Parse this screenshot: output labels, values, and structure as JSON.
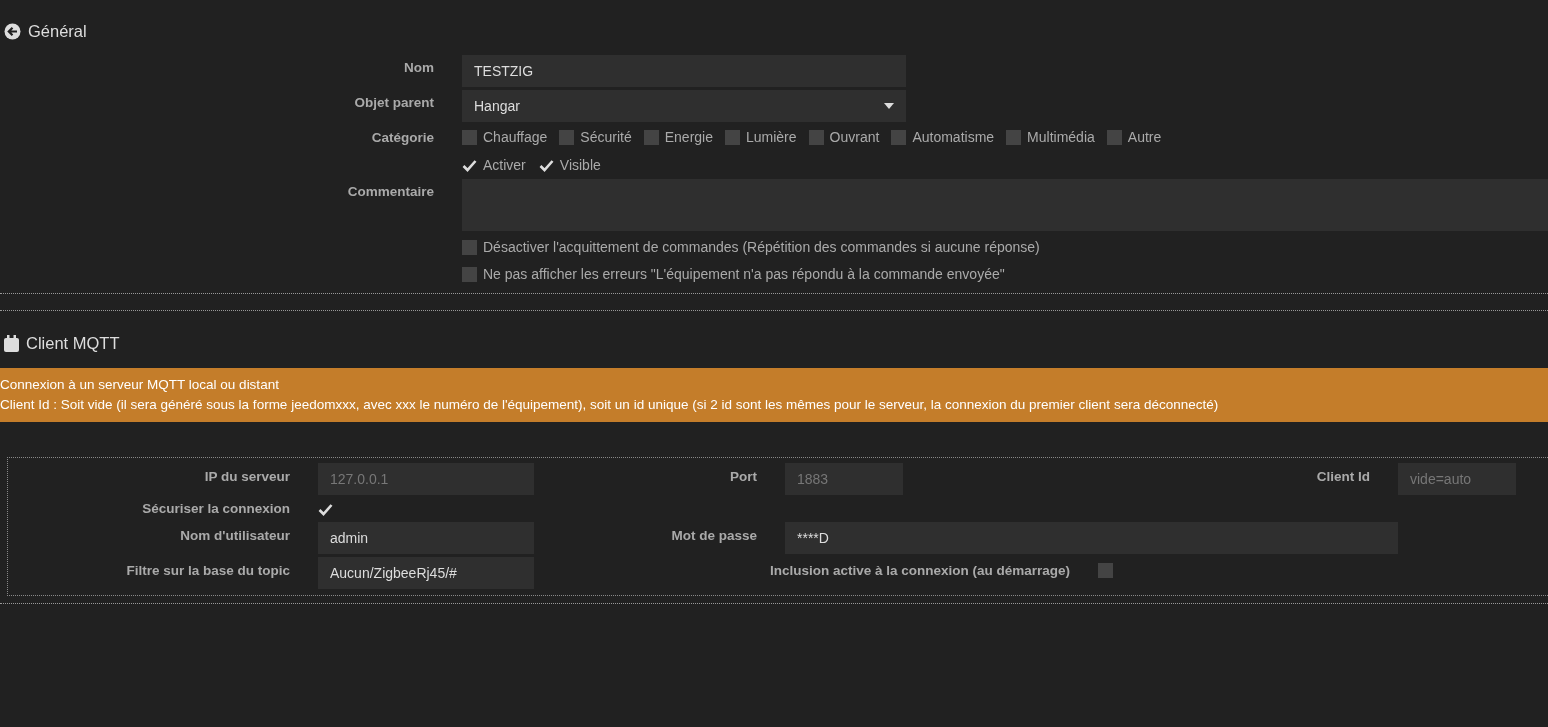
{
  "general": {
    "title": "Général",
    "fields": [
      {
        "kind": "text",
        "label": "Nom",
        "value": "TESTZIG"
      },
      {
        "kind": "select",
        "label": "Objet parent",
        "value": "Hangar"
      }
    ],
    "category": {
      "label": "Catégorie",
      "options": [
        {
          "label": "Chauffage",
          "checked": false
        },
        {
          "label": "Sécurité",
          "checked": false
        },
        {
          "label": "Energie",
          "checked": false
        },
        {
          "label": "Lumière",
          "checked": false
        },
        {
          "label": "Ouvrant",
          "checked": false
        },
        {
          "label": "Automatisme",
          "checked": false
        },
        {
          "label": "Multimédia",
          "checked": false
        },
        {
          "label": "Autre",
          "checked": false
        }
      ]
    },
    "flags": [
      {
        "label": "Activer",
        "checked": true
      },
      {
        "label": "Visible",
        "checked": true
      }
    ],
    "comment": {
      "label": "Commentaire"
    },
    "options": [
      {
        "label": "Désactiver l'acquittement de commandes (Répétition des commandes si aucune réponse)",
        "checked": false
      },
      {
        "label": "Ne pas afficher les erreurs \"L'équipement n'a pas répondu à la commande envoyée\"",
        "checked": false
      }
    ]
  },
  "mqtt": {
    "title": "Client MQTT",
    "notice": [
      "Connexion à un serveur MQTT local ou distant",
      "Client Id : Soit vide (il sera généré sous la forme jeedomxxx, avec xxx le numéro de l'équipement), soit un id unique (si 2 id sont les mêmes pour le serveur, la connexion du premier client sera déconnecté)"
    ],
    "rows": [
      [
        {
          "kind": "input",
          "label": "IP du serveur",
          "placeholder": "127.0.0.1"
        },
        {
          "kind": "input",
          "label": "Port",
          "placeholder": "1883"
        },
        {
          "kind": "input",
          "label": "Client Id",
          "placeholder": "vide=auto"
        }
      ],
      [
        {
          "kind": "checkbox",
          "label": "Sécuriser la connexion",
          "checked": true
        }
      ],
      [
        {
          "kind": "input",
          "label": "Nom d'utilisateur",
          "value": "admin"
        },
        {
          "kind": "input_wide",
          "label": "Mot de passe",
          "value": "****D"
        }
      ],
      [
        {
          "kind": "input",
          "label": "Filtre sur la base du topic",
          "value": "Aucun/ZigbeeRj45/#"
        },
        {
          "kind": "checkbox_after",
          "label": "Inclusion active à la connexion (au démarrage)",
          "checked": false
        }
      ]
    ]
  }
}
